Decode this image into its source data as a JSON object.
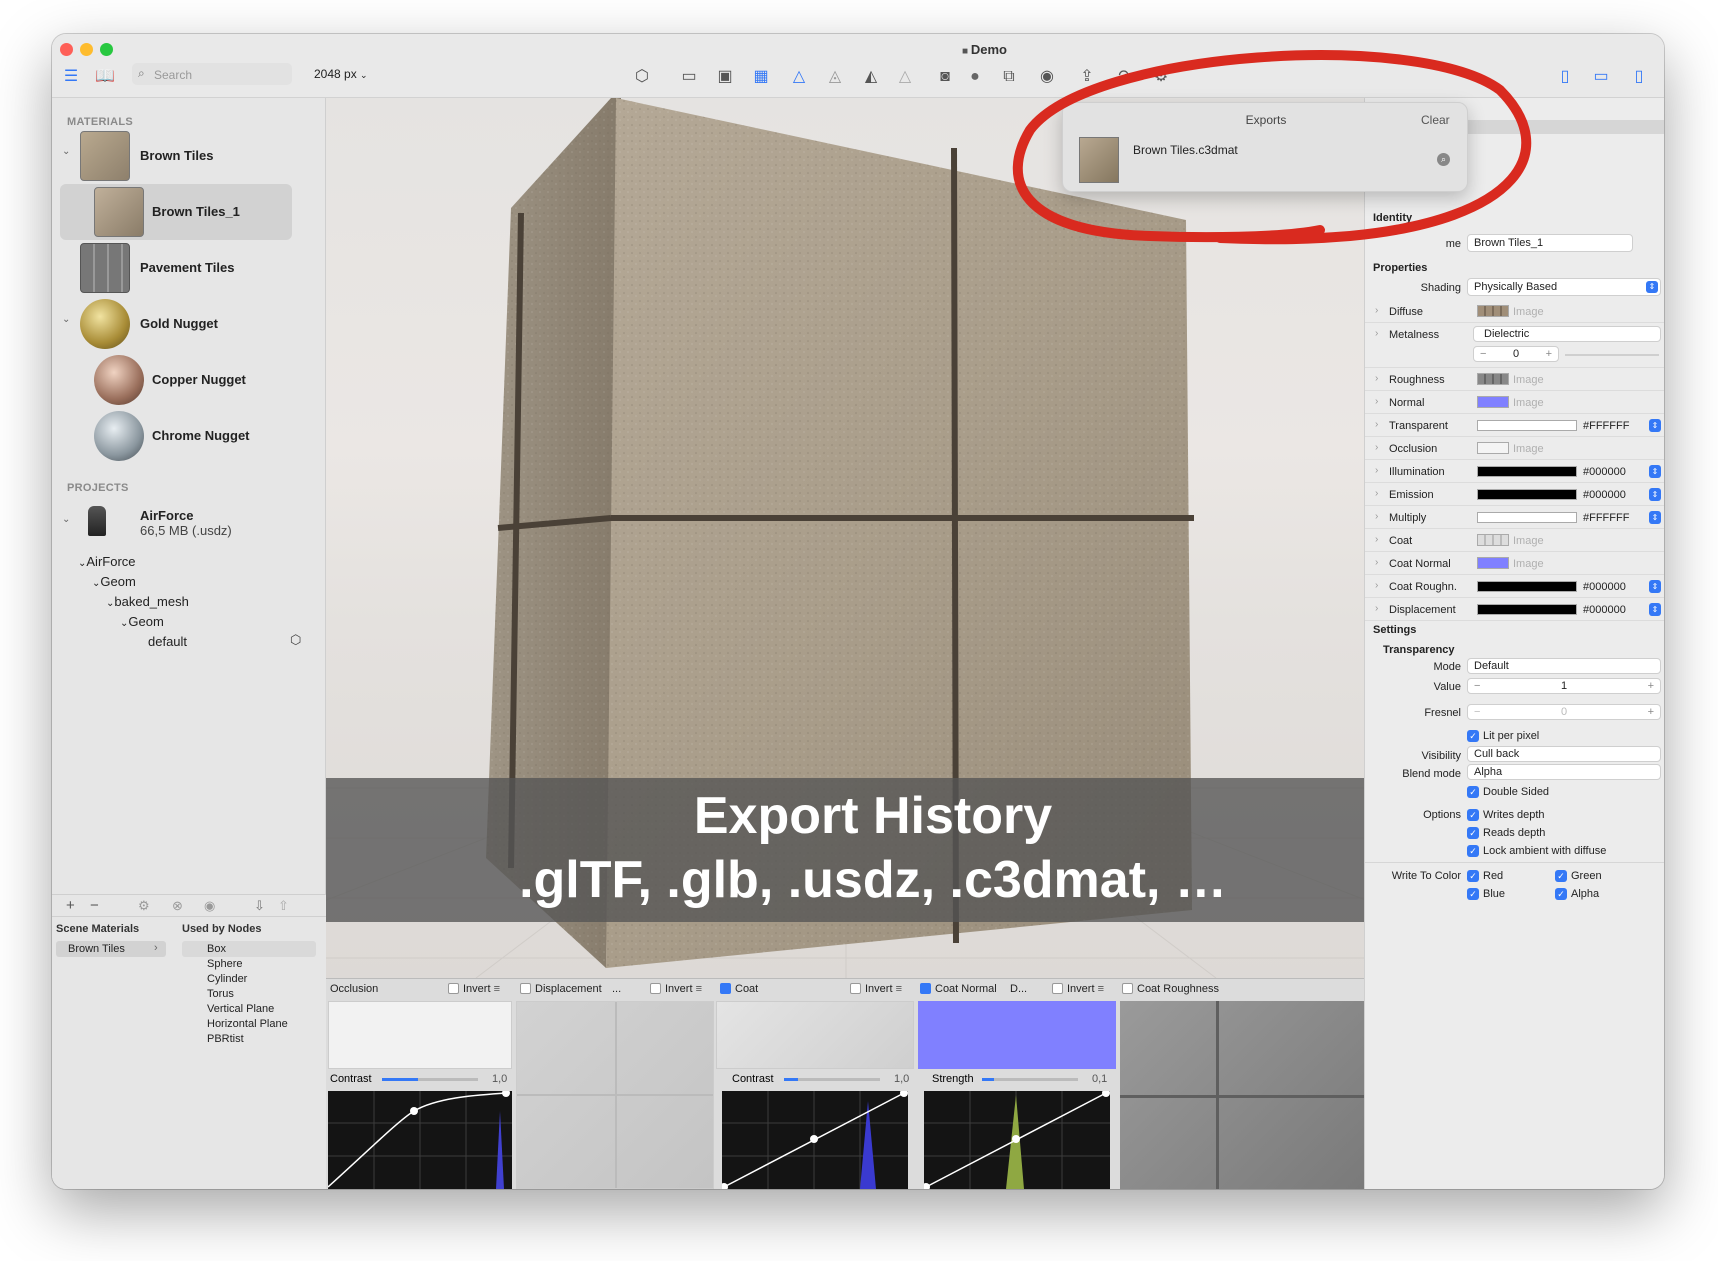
{
  "window": {
    "title": "Demo"
  },
  "toolbar": {
    "resolution": "2048 px",
    "search_placeholder": "Search"
  },
  "sidebar": {
    "materials_header": "MATERIALS",
    "materials": [
      {
        "label": "Brown Tiles"
      },
      {
        "label": "Brown Tiles_1"
      },
      {
        "label": "Pavement Tiles"
      },
      {
        "label": "Gold Nugget"
      },
      {
        "label": "Copper Nugget"
      },
      {
        "label": "Chrome Nugget"
      }
    ],
    "projects_header": "PROJECTS",
    "project": {
      "name": "AirForce",
      "size": "66,5 MB (.usdz)"
    },
    "tree": [
      "AirForce",
      "Geom",
      "baked_mesh",
      "Geom",
      "default"
    ]
  },
  "scene": {
    "scene_materials_header": "Scene Materials",
    "used_by_header": "Used by Nodes",
    "scene_item": "Brown Tiles",
    "nodes": [
      "Box",
      "Sphere",
      "Cylinder",
      "Torus",
      "Vertical Plane",
      "Horizontal Plane",
      "PBRtist"
    ]
  },
  "overlay": {
    "line1": "Export History",
    "line2": ".glTF, .glb, .usdz, .c3dmat, …"
  },
  "exports": {
    "title": "Exports",
    "clear": "Clear",
    "item": "Brown Tiles.c3dmat"
  },
  "inspector": {
    "identity_header": "Identity",
    "name_label": "me",
    "name_value": "Brown Tiles_1",
    "properties_header": "Properties",
    "shading_label": "Shading",
    "shading_value": "Physically Based",
    "rows": [
      {
        "label": "Diffuse",
        "kind": "image",
        "value": "Image"
      },
      {
        "label": "Metalness",
        "kind": "select",
        "value": "Dielectric"
      },
      {
        "label": "Roughness",
        "kind": "image",
        "value": "Image"
      },
      {
        "label": "Normal",
        "kind": "image",
        "value": "Image"
      },
      {
        "label": "Transparent",
        "kind": "color",
        "value": "#FFFFFF"
      },
      {
        "label": "Occlusion",
        "kind": "image",
        "value": "Image"
      },
      {
        "label": "Illumination",
        "kind": "color",
        "value": "#000000"
      },
      {
        "label": "Emission",
        "kind": "color",
        "value": "#000000"
      },
      {
        "label": "Multiply",
        "kind": "color",
        "value": "#FFFFFF"
      },
      {
        "label": "Coat",
        "kind": "image",
        "value": "Image"
      },
      {
        "label": "Coat Normal",
        "kind": "image",
        "value": "Image"
      },
      {
        "label": "Coat Roughn.",
        "kind": "color",
        "value": "#000000"
      },
      {
        "label": "Displacement",
        "kind": "color",
        "value": "#000000"
      }
    ],
    "metal_value": "0",
    "settings_header": "Settings",
    "transparency_header": "Transparency",
    "mode_label": "Mode",
    "mode_value": "Default",
    "value_label": "Value",
    "value_value": "1",
    "fresnel_label": "Fresnel",
    "fresnel_value": "0",
    "lit_per_pixel": "Lit per pixel",
    "visibility_label": "Visibility",
    "visibility_value": "Cull back",
    "blend_label": "Blend mode",
    "blend_value": "Alpha",
    "double_sided": "Double Sided",
    "options_label": "Options",
    "writes_depth": "Writes depth",
    "reads_depth": "Reads depth",
    "lock_ambient": "Lock ambient with diffuse",
    "write_color_label": "Write To Color",
    "red": "Red",
    "green": "Green",
    "blue": "Blue",
    "alpha": "Alpha"
  },
  "bottom": {
    "occlusion": "Occlusion",
    "invert": "Invert",
    "displacement": "Displacement",
    "coat": "Coat",
    "coat_normal": "Coat Normal",
    "coat_roughness": "Coat Roughness",
    "d_select": "D...",
    "dots": "...",
    "contrast": "Contrast",
    "strength": "Strength",
    "occ_contrast_value": "1,0",
    "coat_contrast_value": "1,0",
    "strength_value": "0,1"
  },
  "colors": {
    "accent": "#3478f6",
    "annotation": "#d92a1f",
    "normal_map": "#8080ff"
  }
}
